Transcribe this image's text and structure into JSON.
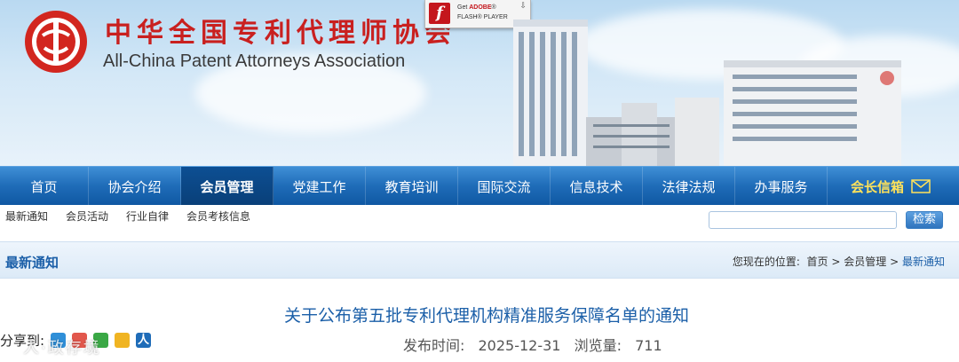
{
  "header": {
    "cn_name": "中华全国专利代理师协会",
    "en_name": "All-China Patent Attorneys Association",
    "flash_badge": {
      "line1_prefix": "Get ",
      "line1_brand": "ADOBE",
      "line1_suffix": "®",
      "line2": "FLASH® PLAYER"
    }
  },
  "nav": {
    "items": [
      {
        "label": "首页"
      },
      {
        "label": "协会介绍"
      },
      {
        "label": "会员管理"
      },
      {
        "label": "党建工作"
      },
      {
        "label": "教育培训"
      },
      {
        "label": "国际交流"
      },
      {
        "label": "信息技术"
      },
      {
        "label": "法律法规"
      },
      {
        "label": "办事服务"
      },
      {
        "label": "会长信箱"
      }
    ],
    "active": "会员管理"
  },
  "subnav": {
    "links": [
      "最新通知",
      "会员活动",
      "行业自律",
      "会员考核信息"
    ],
    "search_button": "检索",
    "search_value": ""
  },
  "section": {
    "title": "最新通知",
    "breadcrumb_label": "您现在的位置:",
    "crumbs": [
      "首页",
      "会员管理",
      "最新通知"
    ],
    "separator": ">"
  },
  "article": {
    "title": "关于公布第五批专利代理机构精准服务保障名单的通知",
    "publish_label": "发布时间:",
    "publish_date": "2025-12-31",
    "views_label": "浏览量:",
    "views": "711"
  },
  "share": {
    "label": "分享到:",
    "icons": [
      "qzone-icon",
      "tencent-weibo-icon",
      "wechat-icon",
      "qq-star-icon",
      "renren-icon"
    ]
  },
  "watermark": "人·政存境",
  "colors": {
    "brand_red": "#c9201f",
    "nav_blue": "#1f6cb8",
    "nav_active": "#0d4f93",
    "link_blue": "#1b5fa8",
    "mail_yellow": "#ffe25a"
  }
}
